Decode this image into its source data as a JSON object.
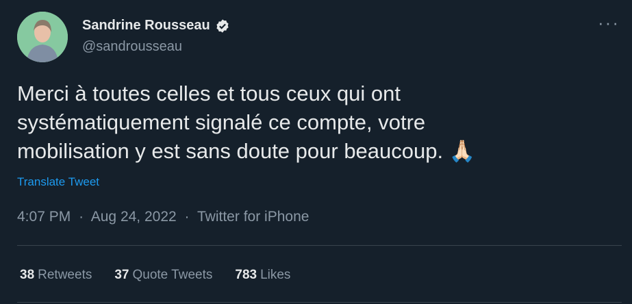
{
  "user": {
    "display_name": "Sandrine Rousseau",
    "handle": "@sandrousseau",
    "verified_icon": "verified-badge-icon"
  },
  "tweet": {
    "text_lines": [
      "Merci à toutes celles et tous ceux qui ont",
      "systématiquement signalé ce compte, votre",
      "mobilisation y est sans doute pour beaucoup."
    ],
    "emoji": "🙏🏻",
    "translate_label": "Translate Tweet",
    "time": "4:07 PM",
    "date": "Aug 24, 2022",
    "source": "Twitter for iPhone",
    "separator": "·"
  },
  "stats": {
    "retweets_count": "38",
    "retweets_label": "Retweets",
    "quotes_count": "37",
    "quotes_label": "Quote Tweets",
    "likes_count": "783",
    "likes_label": "Likes"
  },
  "colors": {
    "background": "#15202b",
    "text": "#e7e9ea",
    "muted": "#8b98a5",
    "link": "#1d9bf0"
  }
}
